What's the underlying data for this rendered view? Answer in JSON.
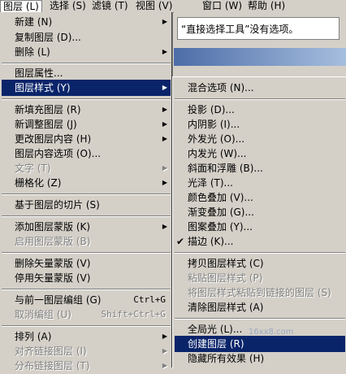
{
  "menubar": {
    "items": [
      {
        "label": "图层 (L)"
      },
      {
        "label": "选择 (S)"
      },
      {
        "label": "滤镜 (T)"
      },
      {
        "label": "视图 (V)"
      },
      {
        "label": "窗口 (W)"
      },
      {
        "label": "帮助 (H)"
      }
    ]
  },
  "info": {
    "message": "“直接选择工具”没有选项。"
  },
  "layer_menu": {
    "new": "新建 (N)",
    "duplicate": "复制图层 (D)...",
    "delete": "删除 (L)",
    "properties": "图层属性...",
    "style": "图层样式 (Y)",
    "new_fill": "新填充图层 (R)",
    "new_adjust": "新调整图层 (J)",
    "change_content": "更改图层内容 (H)",
    "content_options": "图层内容选项 (O)...",
    "type": "文字 (T)",
    "rasterize": "栅格化 (Z)",
    "slice": "基于图层的切片 (S)",
    "add_mask": "添加图层蒙版 (K)",
    "enable_mask": "启用图层蒙版 (B)",
    "delete_vmask": "删除矢量蒙版 (V)",
    "disable_vmask": "停用矢量蒙版 (V)",
    "group_prev": "与前一图层编组 (G)",
    "group_prev_sc": "Ctrl+G",
    "ungroup": "取消编组 (U)",
    "ungroup_sc": "Shift+Ctrl+G",
    "arrange": "排列 (A)",
    "align_linked": "对齐链接图层 (I)",
    "distribute_linked": "分布链接图层 (T)"
  },
  "style_menu": {
    "blend": "混合选项 (N)...",
    "drop_shadow": "投影 (D)...",
    "inner_shadow": "内阴影 (I)...",
    "outer_glow": "外发光 (O)...",
    "inner_glow": "内发光 (W)...",
    "bevel": "斜面和浮雕 (B)...",
    "satin": "光泽 (T)...",
    "color_overlay": "颜色叠加 (V)...",
    "gradient_overlay": "渐变叠加 (G)...",
    "pattern_overlay": "图案叠加 (Y)...",
    "stroke": "描边 (K)...",
    "stroke_check": "✔",
    "copy_style": "拷贝图层样式 (C)",
    "paste_style": "粘贴图层样式 (P)",
    "paste_linked": "将图层样式粘贴到链接的图层 (S)",
    "clear_style": "清除图层样式 (A)",
    "global_light": "全局光 (L)...",
    "create_layer": "创建图层 (R)",
    "hide_effects": "隐藏所有效果 (H)"
  },
  "watermark": "16xx8.com"
}
